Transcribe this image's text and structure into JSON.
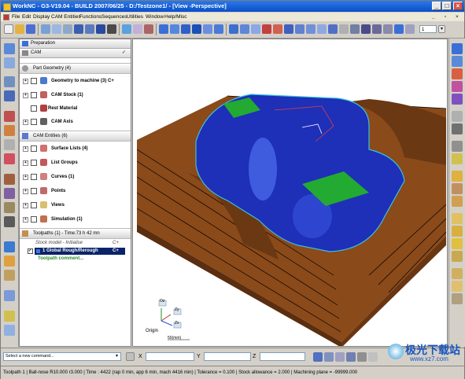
{
  "window": {
    "title": "WorkNC  - G3-V19.04 - BUILD 2007/06/25 - D:/Testzone1/ - [View -Perspective]",
    "controls": [
      "_",
      "□",
      "×"
    ]
  },
  "menu": [
    "File",
    "Edit",
    "Display",
    "CAM Entities",
    "Functions",
    "Sequences",
    "Utilities",
    "Window",
    "Help/Misc"
  ],
  "toolbar": {
    "dropdown_value": "1"
  },
  "panel": {
    "header_preparation": "Preparation",
    "header_cam": "CAM",
    "part_geometry": "Part Geometry (4)",
    "part_items": [
      "Geometry to machine (3)  C+",
      "CAM Stock (1)",
      "Rest Material",
      "CAM Axis"
    ],
    "cam_entities": "CAM Entities (6)",
    "entity_items": [
      "Surface Lists (4)",
      "List Groups",
      "Curves (1)",
      "Points",
      "Views",
      "Simulation (1)"
    ],
    "toolpaths": "Toolpaths (1) - Time:73 h 42 mn",
    "toolpath_items": [
      {
        "label": "Stock model - Initialise",
        "suffix": "C+"
      },
      {
        "label": "1 Global Rough/Rerough",
        "suffix": "C+"
      },
      {
        "label": "Toolpath comment..."
      }
    ]
  },
  "viewport": {
    "axis": {
      "x": "Zx",
      "y": "Zy",
      "z": "Oz",
      "origin": "Origin",
      "scale": "50(mm)"
    },
    "colors": {
      "base": "#8a4a1a",
      "part": "#1e2fb8",
      "highlight": "#22aa33",
      "bg": "#ffffff"
    }
  },
  "commandbar": {
    "placeholder": "Select a new command...",
    "x_label": "X",
    "y_label": "Y",
    "z_label": "Z"
  },
  "statusbar": {
    "text": "Toolpath 1 | Ball-nose R10.000 r3.000 | Time : 4422 (rap 0 min, app 6 min, mach 4416 min) | Tolerance = 0.100 | Stock allowance = 2.000 | Machining plane = -99999.000"
  },
  "watermark": {
    "cn": "极光下载站",
    "url": "www.xz7.com"
  }
}
